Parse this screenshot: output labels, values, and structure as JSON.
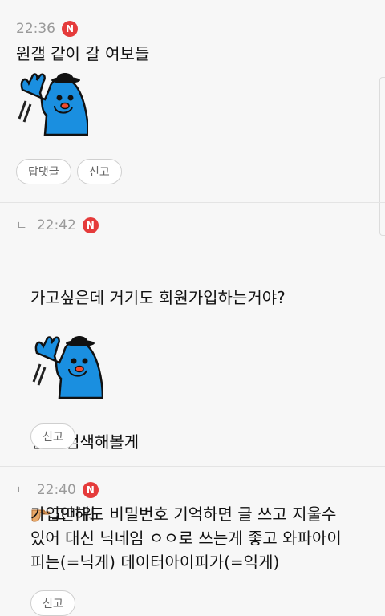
{
  "comments": [
    {
      "time": "22:36",
      "badge": "N",
      "text": "원갤 같이 갈 여보들",
      "sticker": "waving-blue-character",
      "buttons": [
        "답댓글",
        "신고"
      ]
    },
    {
      "reply_mark": "ㄴ",
      "time": "22:42",
      "badge": "N",
      "text_lines": [
        "가고싶은데 거기도 회원가입하는거야?",
        "",
        "일단 검색해볼게"
      ],
      "emoji": "point-right-hand-icon",
      "emoji_text": "고마워",
      "sticker": "waving-blue-character",
      "buttons": [
        "신고"
      ]
    },
    {
      "reply_mark": "ㄴ",
      "time": "22:40",
      "badge": "N",
      "text": "가입안해도 비밀번호 기억하면 글 쓰고 지울수\n있어 대신 닉네임 ㅇㅇ로 쓰는게 좋고 와파아이\n피는(=닉게) 데이터아이피가(=익게)",
      "buttons": [
        "신고"
      ]
    }
  ],
  "colors": {
    "badge": "#e53b3b",
    "sticker_body": "#1a8fe0",
    "background": "#f7f7f7"
  }
}
